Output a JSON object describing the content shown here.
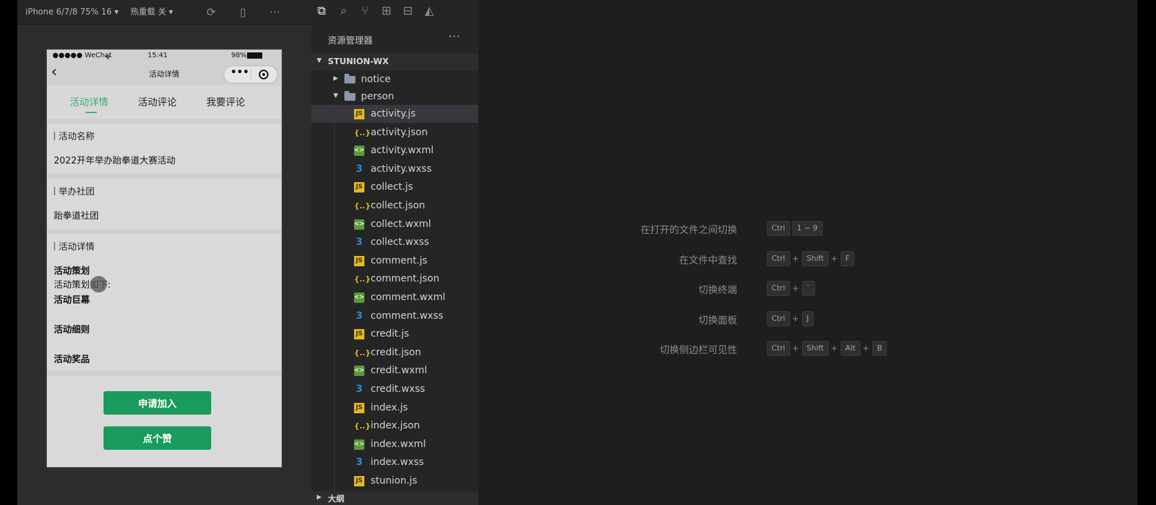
{
  "simulator": {
    "toolbar": {
      "device": "iPhone 6/7/8 75% 16 ▾",
      "hot_reload": "热重载 关 ▾"
    },
    "status_bar": {
      "carrier": "●●●●● WeChat",
      "time": "15:41",
      "battery": "98%"
    },
    "nav": {
      "title": "活动详情"
    },
    "tabs": [
      {
        "label": "活动详情",
        "active": true
      },
      {
        "label": "活动评论",
        "active": false
      },
      {
        "label": "我要评论",
        "active": false
      }
    ],
    "sections": {
      "name_label": "活动名称",
      "name_value": "2022开年举办跆拳道大赛活动",
      "club_label": "举办社团",
      "club_value": "跆拳道社团",
      "detail_label": "活动详情"
    },
    "details": {
      "plan_title": "活动策划",
      "plan_text": "活动策划如下:",
      "banner_title": "活动巨幕",
      "rules_title": "活动细则",
      "prizes_title": "活动奖品"
    },
    "buttons": {
      "join": "申请加入",
      "like": "点个赞"
    }
  },
  "explorer": {
    "title": "资源管理器",
    "project": "STUNION-WX",
    "folders": {
      "notice": "notice",
      "person": "person"
    },
    "files": [
      {
        "name": "activity.js",
        "type": "js",
        "icon_text": "JS",
        "selected": true
      },
      {
        "name": "activity.json",
        "type": "json",
        "icon_text": "{..}"
      },
      {
        "name": "activity.wxml",
        "type": "wxml",
        "icon_text": "<>"
      },
      {
        "name": "activity.wxss",
        "type": "wxss",
        "icon_text": "3"
      },
      {
        "name": "collect.js",
        "type": "js",
        "icon_text": "JS"
      },
      {
        "name": "collect.json",
        "type": "json",
        "icon_text": "{..}"
      },
      {
        "name": "collect.wxml",
        "type": "wxml",
        "icon_text": "<>"
      },
      {
        "name": "collect.wxss",
        "type": "wxss",
        "icon_text": "3"
      },
      {
        "name": "comment.js",
        "type": "js",
        "icon_text": "JS"
      },
      {
        "name": "comment.json",
        "type": "json",
        "icon_text": "{..}"
      },
      {
        "name": "comment.wxml",
        "type": "wxml",
        "icon_text": "<>"
      },
      {
        "name": "comment.wxss",
        "type": "wxss",
        "icon_text": "3"
      },
      {
        "name": "credit.js",
        "type": "js",
        "icon_text": "JS"
      },
      {
        "name": "credit.json",
        "type": "json",
        "icon_text": "{..}"
      },
      {
        "name": "credit.wxml",
        "type": "wxml",
        "icon_text": "<>"
      },
      {
        "name": "credit.wxss",
        "type": "wxss",
        "icon_text": "3"
      },
      {
        "name": "index.js",
        "type": "js",
        "icon_text": "JS"
      },
      {
        "name": "index.json",
        "type": "json",
        "icon_text": "{..}"
      },
      {
        "name": "index.wxml",
        "type": "wxml",
        "icon_text": "<>"
      },
      {
        "name": "index.wxss",
        "type": "wxss",
        "icon_text": "3"
      },
      {
        "name": "stunion.js",
        "type": "js",
        "icon_text": "JS"
      }
    ],
    "outline": "大纲"
  },
  "editor": {
    "shortcuts": [
      {
        "label": "在打开的文件之间切换",
        "keys": [
          "Ctrl",
          "1 ~ 9"
        ]
      },
      {
        "label": "在文件中查找",
        "keys": [
          "Ctrl",
          "+",
          "Shift",
          "+",
          "F"
        ]
      },
      {
        "label": "切换终端",
        "keys": [
          "Ctrl",
          "+",
          "`"
        ]
      },
      {
        "label": "切换面板",
        "keys": [
          "Ctrl",
          "+",
          "J"
        ]
      },
      {
        "label": "切换侧边栏可见性",
        "keys": [
          "Ctrl",
          "+",
          "Shift",
          "+",
          "Alt",
          "+",
          "B"
        ]
      }
    ]
  },
  "colors": {
    "accent_green": "#3fae73",
    "button_green": "#1a9a5c",
    "js_yellow": "#e5b822",
    "wxss_blue": "#2a8ad8"
  }
}
